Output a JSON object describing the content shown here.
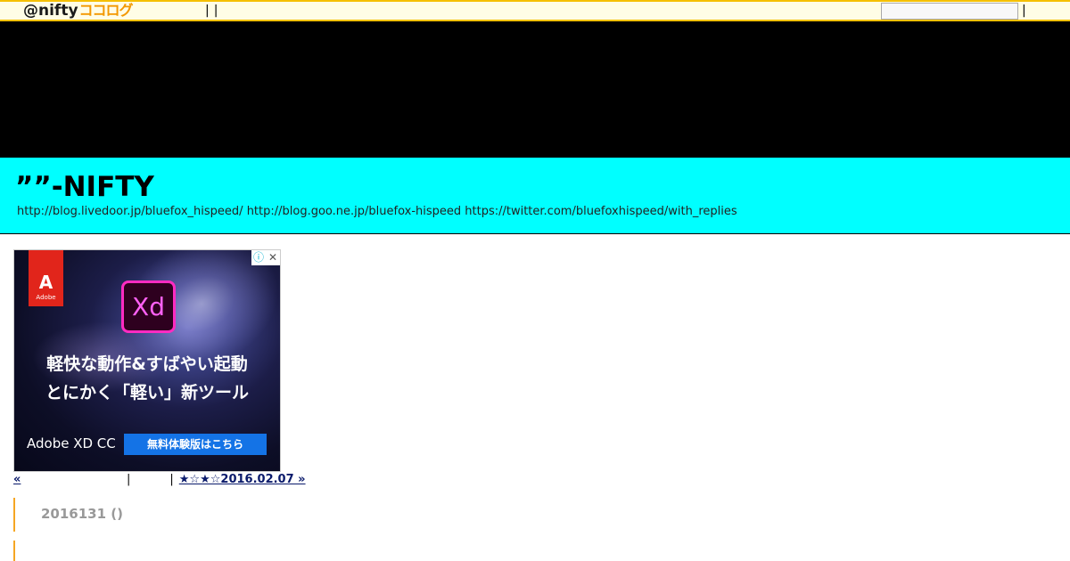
{
  "topbar": {
    "logo_at": "@nifty",
    "logo_kokolog": "ココログ",
    "nav_sep1": "|",
    "nav_sep2": "|",
    "nav_link": "",
    "search_value": "",
    "search_sep": "|",
    "accent_color": "#f5c000"
  },
  "header": {
    "title": "””-NIFTY",
    "description": "http://blog.livedoor.jp/bluefox_hispeed/ http://blog.goo.ne.jp/bluefox-hispeed  https://twitter.com/bluefoxhispeed/with_replies",
    "background_color": "#00ffff"
  },
  "ad": {
    "adobe_mark": "A",
    "adobe_text": "Adobe",
    "app_icon": "Xd",
    "info_icon": "ⓘ",
    "close_icon": "✕",
    "copy_line1": "軽快な動作&すばやい起動",
    "copy_line2": "とにかく「軽い」新ツール",
    "product": "Adobe XD CC",
    "cta": "無料体験版はこちら"
  },
  "pager": {
    "prev": "«",
    "sep1": "|",
    "top": "",
    "sep2": "|",
    "next": "★☆★☆2016.02.07 »"
  },
  "entry": {
    "date": "2016131 ()"
  }
}
